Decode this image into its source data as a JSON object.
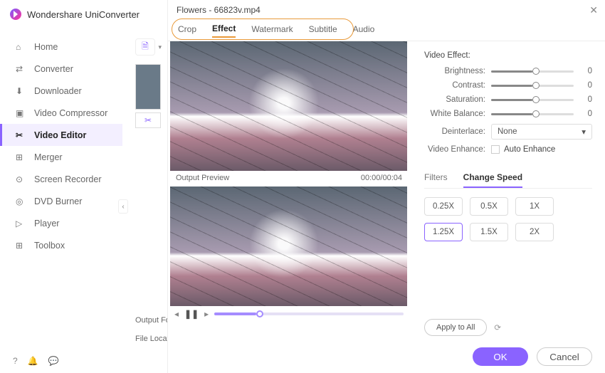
{
  "app": {
    "name": "Wondershare UniConverter"
  },
  "sidebar": {
    "items": [
      {
        "label": "Home"
      },
      {
        "label": "Converter"
      },
      {
        "label": "Downloader"
      },
      {
        "label": "Video Compressor"
      },
      {
        "label": "Video Editor"
      },
      {
        "label": "Merger"
      },
      {
        "label": "Screen Recorder"
      },
      {
        "label": "DVD Burner"
      },
      {
        "label": "Player"
      },
      {
        "label": "Toolbox"
      }
    ]
  },
  "content": {
    "output_format_label": "Output Form",
    "file_location_label": "File Location"
  },
  "dialog": {
    "title": "Flowers - 66823v.mp4",
    "tabs": [
      {
        "label": "Crop"
      },
      {
        "label": "Effect"
      },
      {
        "label": "Watermark"
      },
      {
        "label": "Subtitle"
      },
      {
        "label": "Audio"
      }
    ],
    "preview": {
      "label": "Output Preview",
      "time": "00:00/00:04"
    },
    "effect": {
      "title": "Video Effect:",
      "sliders": [
        {
          "label": "Brightness:",
          "value": "0"
        },
        {
          "label": "Contrast:",
          "value": "0"
        },
        {
          "label": "Saturation:",
          "value": "0"
        },
        {
          "label": "White Balance:",
          "value": "0"
        }
      ],
      "deinterlace_label": "Deinterlace:",
      "deinterlace_value": "None",
      "enhance_label": "Video Enhance:",
      "auto_enhance": "Auto Enhance"
    },
    "subtabs": {
      "filters": "Filters",
      "change_speed": "Change Speed"
    },
    "speeds": [
      "0.25X",
      "0.5X",
      "1X",
      "1.25X",
      "1.5X",
      "2X"
    ],
    "apply_all": "Apply to All",
    "ok": "OK",
    "cancel": "Cancel"
  }
}
